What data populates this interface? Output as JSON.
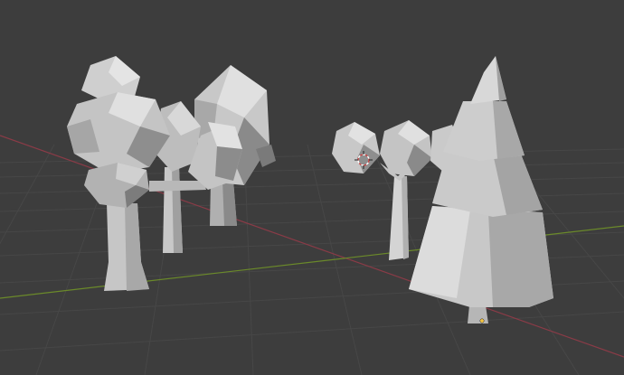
{
  "viewport": {
    "background": "#3d3d3d",
    "grid_color": "#474747",
    "x_axis_color": "#8a3b47",
    "y_axis_color": "#6b8a2a",
    "object_colors": {
      "light": "#d2d2d2",
      "mid": "#b0b0b0",
      "dark": "#8a8a8a",
      "shadow": "#5e5e5e"
    }
  },
  "scene": {
    "objects": [
      "low-poly-tree-1",
      "low-poly-tree-2",
      "low-poly-tree-3",
      "low-poly-tree-4",
      "low-poly-pine-tree"
    ],
    "icons": [
      "3d-cursor-icon",
      "origin-point-icon"
    ]
  }
}
